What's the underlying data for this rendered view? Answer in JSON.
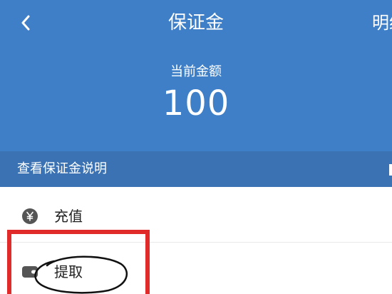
{
  "header": {
    "title": "保证金",
    "detail_link": "明细",
    "amount_label": "当前金额",
    "amount_value": "100",
    "background_color": "#3f7fc7"
  },
  "icons": {
    "back": "chevron-left-icon",
    "recharge": "yuan-circle-icon",
    "withdraw": "wallet-icon"
  },
  "info_bar": {
    "label": "查看保证金说明"
  },
  "menu": {
    "items": [
      {
        "label": "充值",
        "icon": "yuan-circle-icon"
      },
      {
        "label": "提取",
        "icon": "wallet-icon"
      }
    ]
  },
  "annotation": {
    "box_color": "#e12a2a",
    "ellipse_color": "#111111"
  }
}
